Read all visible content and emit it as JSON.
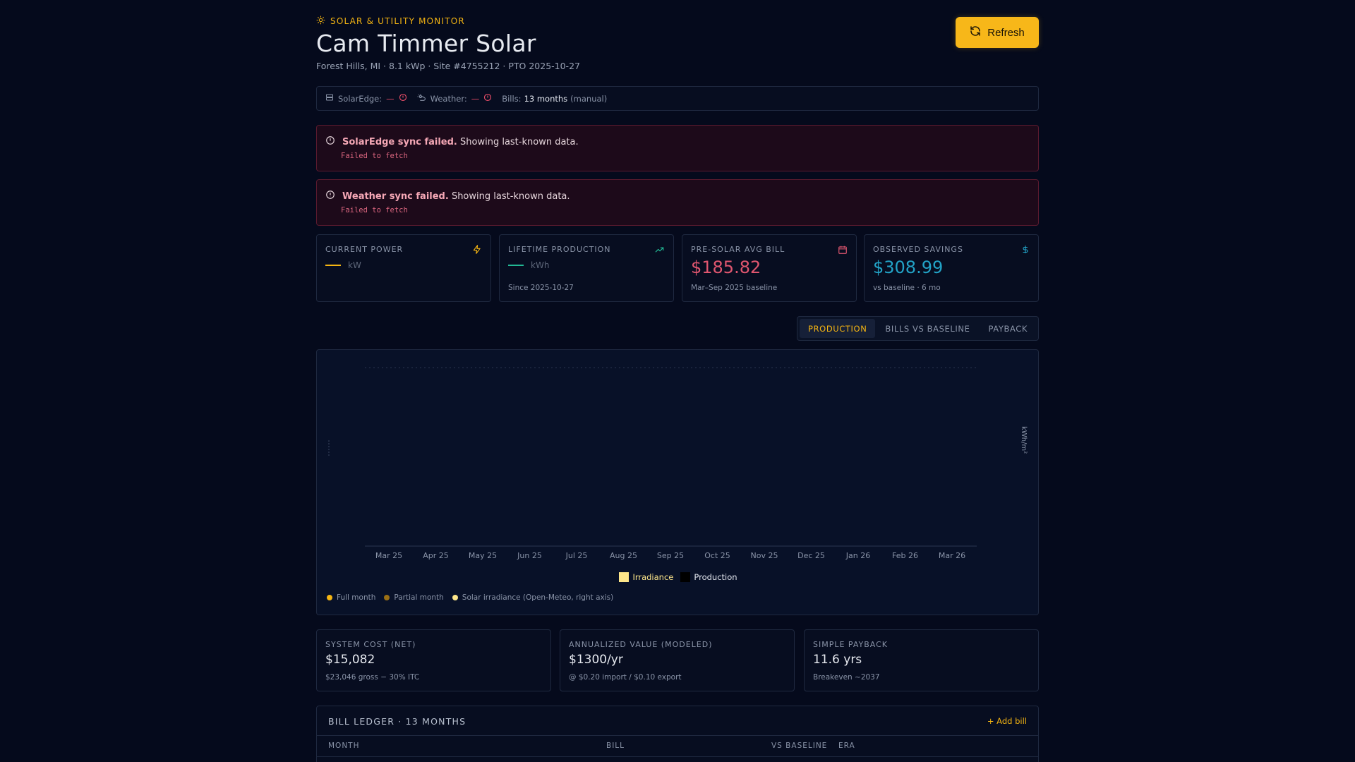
{
  "header": {
    "eyebrow": "SOLAR & UTILITY MONITOR",
    "title": "Cam Timmer Solar",
    "subtitle": "Forest Hills, MI · 8.1 kWp · Site #4755212 · PTO 2025-10-27",
    "refresh_label": "Refresh"
  },
  "status": {
    "solaredge_label": "SolarEdge:",
    "solaredge_value": "—",
    "weather_label": "Weather:",
    "weather_value": "—",
    "bills_label": "Bills:",
    "bills_value": "13 months",
    "bills_note": "(manual)"
  },
  "alerts": [
    {
      "title": "SolarEdge sync failed.",
      "message": "Showing last-known data.",
      "detail": "Failed to fetch"
    },
    {
      "title": "Weather sync failed.",
      "message": "Showing last-known data.",
      "detail": "Failed to fetch"
    }
  ],
  "kpis": {
    "current_power": {
      "label": "CURRENT POWER",
      "unit": "kW"
    },
    "lifetime": {
      "label": "LIFETIME PRODUCTION",
      "unit": "kWh",
      "sub": "Since 2025-10-27"
    },
    "presolar": {
      "label": "PRE-SOLAR AVG BILL",
      "value": "$185.82",
      "sub": "Mar–Sep 2025 baseline"
    },
    "savings": {
      "label": "OBSERVED SAVINGS",
      "value": "$308.99",
      "sub": "vs baseline · 6 mo"
    }
  },
  "tabs": [
    "PRODUCTION",
    "BILLS VS BASELINE",
    "PAYBACK"
  ],
  "colors": {
    "accent": "#f5b512",
    "danger": "#ef4f6a",
    "presolar": "#e0566f",
    "savings": "#22a3c7",
    "lifetime": "#22b894",
    "irradiance": "#fde68a",
    "production": "#000000"
  },
  "chart_data": {
    "type": "bar",
    "categories": [
      "Mar 25",
      "Apr 25",
      "May 25",
      "Jun 25",
      "Jul 25",
      "Aug 25",
      "Sep 25",
      "Oct 25",
      "Nov 25",
      "Dec 25",
      "Jan 26",
      "Feb 26",
      "Mar 26"
    ],
    "series": [
      {
        "name": "Irradiance",
        "values": []
      },
      {
        "name": "Production",
        "values": []
      }
    ],
    "y2label": "kWh/m²",
    "grid": true,
    "legend": "bottom-center"
  },
  "chart_notes": [
    "Full month",
    "Partial month",
    "Solar irradiance (Open-Meteo, right axis)"
  ],
  "stats": [
    {
      "label": "SYSTEM COST (NET)",
      "value": "$15,082",
      "sub": "$23,046 gross − 30% ITC"
    },
    {
      "label": "ANNUALIZED VALUE (MODELED)",
      "value": "$1300/yr",
      "sub": "@ $0.20 import / $0.10 export"
    },
    {
      "label": "SIMPLE PAYBACK",
      "value": "11.6 yrs",
      "sub": "Breakeven ~2037"
    }
  ],
  "ledger": {
    "title": "BILL LEDGER · 13 MONTHS",
    "add_label": "+ Add bill",
    "columns": [
      "MONTH",
      "BILL",
      "VS BASELINE",
      "ERA"
    ]
  }
}
